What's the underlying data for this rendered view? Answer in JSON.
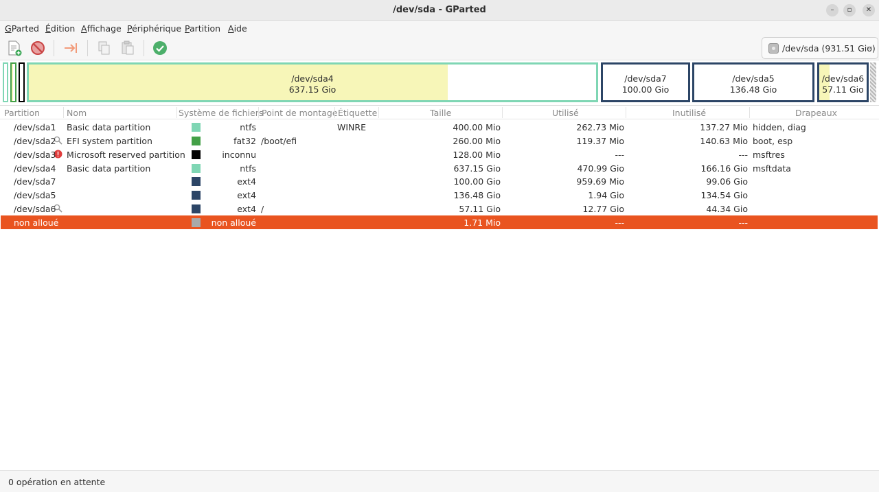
{
  "window": {
    "title": "/dev/sda - GParted",
    "minimize_glyph": "–",
    "maximize_glyph": "▫",
    "close_glyph": "✕"
  },
  "menu": [
    "GParted",
    "Édition",
    "Affichage",
    "Périphérique",
    "Partition",
    "Aide"
  ],
  "toolbar": {
    "icons": [
      "new-partition-icon",
      "delete-icon",
      "resize-move-icon",
      "copy-icon",
      "paste-icon",
      "apply-icon"
    ],
    "device_label": "/dev/sda  (931.51 Gio)",
    "device_chevron": "⌵"
  },
  "diskmap": {
    "partitions": [
      {
        "name": "/dev/sda4",
        "size": "637.15 Gio",
        "used_fraction": 0.739,
        "border_color": "#7fd6b4"
      },
      {
        "name": "/dev/sda7",
        "size": "100.00 Gio",
        "used_fraction": 0.0,
        "border_color": "#2c4566"
      },
      {
        "name": "/dev/sda5",
        "size": "136.48 Gio",
        "used_fraction": 0.0,
        "border_color": "#2c4566"
      },
      {
        "name": "/dev/sda6",
        "size": "57.11 Gio",
        "used_fraction": 0.224,
        "border_color": "#2c4566"
      }
    ]
  },
  "table": {
    "headers": [
      "Partition",
      "Nom",
      "Système de fichiers",
      "Point de montage",
      "Étiquette",
      "Taille",
      "Utilisé",
      "Inutilisé",
      "Drapeaux"
    ],
    "rows": [
      {
        "partition": "/dev/sda1",
        "nom": "Basic data partition",
        "fs_color": "#7fd6b4",
        "fs": "ntfs",
        "mount": "",
        "label": "WINRE",
        "size": "400.00 Mio",
        "used": "262.73 Mio",
        "unused": "137.27 Mio",
        "flags": "hidden, diag",
        "status_icon": ""
      },
      {
        "partition": "/dev/sda2",
        "nom": "EFI system partition",
        "fs_color": "#43a047",
        "fs": "fat32",
        "mount": "/boot/efi",
        "label": "",
        "size": "260.00 Mio",
        "used": "119.37 Mio",
        "unused": "140.63 Mio",
        "flags": "boot, esp",
        "status_icon": "key-icon"
      },
      {
        "partition": "/dev/sda3",
        "nom": "Microsoft reserved partition",
        "fs_color": "#000000",
        "fs": "inconnu",
        "mount": "",
        "label": "",
        "size": "128.00 Mio",
        "used": "---",
        "unused": "---",
        "flags": "msftres",
        "status_icon": "warning-icon"
      },
      {
        "partition": "/dev/sda4",
        "nom": "Basic data partition",
        "fs_color": "#7fd6b4",
        "fs": "ntfs",
        "mount": "",
        "label": "",
        "size": "637.15 Gio",
        "used": "470.99 Gio",
        "unused": "166.16 Gio",
        "flags": "msftdata",
        "status_icon": ""
      },
      {
        "partition": "/dev/sda7",
        "nom": "",
        "fs_color": "#2c4566",
        "fs": "ext4",
        "mount": "",
        "label": "",
        "size": "100.00 Gio",
        "used": "959.69 Mio",
        "unused": "99.06 Gio",
        "flags": "",
        "status_icon": ""
      },
      {
        "partition": "/dev/sda5",
        "nom": "",
        "fs_color": "#2c4566",
        "fs": "ext4",
        "mount": "",
        "label": "",
        "size": "136.48 Gio",
        "used": "1.94 Gio",
        "unused": "134.54 Gio",
        "flags": "",
        "status_icon": ""
      },
      {
        "partition": "/dev/sda6",
        "nom": "",
        "fs_color": "#2c4566",
        "fs": "ext4",
        "mount": "/",
        "label": "",
        "size": "57.11 Gio",
        "used": "12.77 Gio",
        "unused": "44.34 Gio",
        "flags": "",
        "status_icon": "key-icon"
      },
      {
        "partition": "non alloué",
        "nom": "",
        "fs_color": "#a9a9a9",
        "fs": "non alloué",
        "mount": "",
        "label": "",
        "size": "1.71 Mio",
        "used": "---",
        "unused": "---",
        "flags": "",
        "status_icon": "",
        "selected": true
      }
    ]
  },
  "statusbar": {
    "message": "0 opération en attente"
  },
  "colors": {
    "accent": "#e95420",
    "ntfs": "#7fd6b4",
    "fat32": "#43a047",
    "ext4": "#2c4566",
    "used": "#f7f6b8"
  }
}
